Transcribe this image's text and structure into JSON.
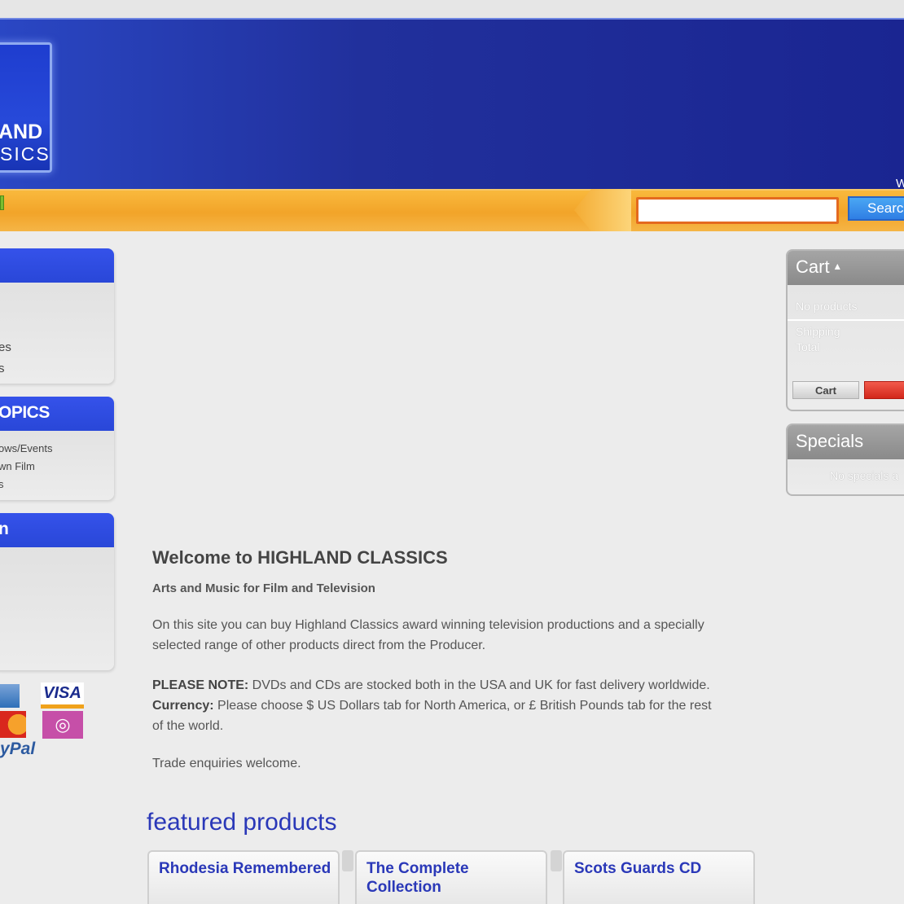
{
  "header": {
    "logo_line1": "AND",
    "logo_line2": "SICS",
    "right_text": "W"
  },
  "search": {
    "value": "",
    "placeholder": "",
    "button_label": "Search"
  },
  "sidebar": {
    "box1": {
      "heading": "",
      "items": [
        "es",
        "s"
      ]
    },
    "box2": {
      "heading": "OPICS",
      "items": [
        "ows/Events",
        "wn Film",
        "s"
      ]
    },
    "box3": {
      "heading": "n"
    },
    "payment_icons": [
      "amex-icon",
      "visa-icon",
      "mastercard-icon",
      "maestro-icon",
      "paypal-icon"
    ],
    "visa_text": "VISA",
    "paypal_text": "yPal"
  },
  "main": {
    "title": "Welcome to HIGHLAND CLASSICS",
    "subtitle": "Arts and Music for Film and Television",
    "intro": "On this site you can buy Highland Classics award winning television productions and a specially selected range of other products direct from the Producer.",
    "note_label": "PLEASE NOTE:",
    "note_text": " DVDs and CDs are stocked both in the USA and UK for fast delivery worldwide.  ",
    "currency_label": "Currency:",
    "currency_text": " Please choose $ US Dollars tab for North America, or £ British Pounds tab for the rest of the world.",
    "trade": "Trade enquiries welcome.",
    "featured_title": "featured products",
    "products": [
      "Rhodesia Remembered",
      "The Complete Collection",
      "Scots Guards CD"
    ]
  },
  "cart": {
    "heading": "Cart",
    "caret": "▴",
    "no_products": "No products",
    "shipping": "Shipping",
    "total": "Total",
    "cart_button": "Cart",
    "checkout_button": ""
  },
  "specials": {
    "heading": "Specials",
    "text": "No specials a"
  },
  "colors": {
    "header_blue": "#21309c",
    "orange_bar": "#f2a429",
    "link_blue": "#2a38b8",
    "checkout_red": "#d2261a"
  }
}
